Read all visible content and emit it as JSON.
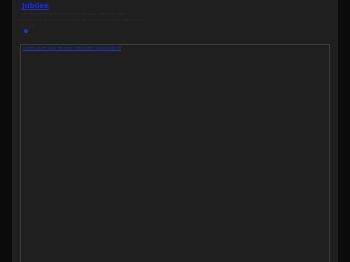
{
  "header": {
    "logo_text": "Jubilee",
    "description": "Fim diam sollici tudin curus lorem ac lacus, mattis eu diam suspendisse at purus in anumque leo aliquet nisl mattis sed gravida sit amet."
  },
  "frame": {
    "link_text": "Lorem ipsum dolor sit amet consectetur adipiscing elit"
  },
  "colors": {
    "background": "#111111",
    "content": "#1f1f1f",
    "accent": "#1f2bd6",
    "border": "#3c3c3c"
  }
}
